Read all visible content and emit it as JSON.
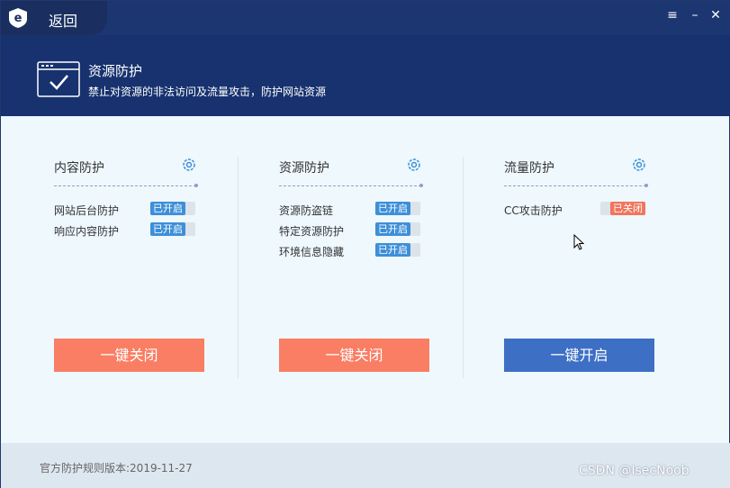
{
  "titlebar": {
    "back_label": "返回",
    "menu_icon": "hamburger-menu-icon",
    "minimize_icon": "minimize-icon",
    "close_icon": "close-icon"
  },
  "header": {
    "title": "资源防护",
    "subtitle": "禁止对资源的非法访问及流量攻击，防护网站资源",
    "icon": "browser-shield-check-icon"
  },
  "columns": [
    {
      "title": "内容防护",
      "rows": [
        {
          "label": "网站后台防护",
          "status": "已开启"
        },
        {
          "label": "响应内容防护",
          "status": "已开启"
        }
      ],
      "button": "一键关闭",
      "button_color": "#f97e64"
    },
    {
      "title": "资源防护",
      "rows": [
        {
          "label": "资源防盗链",
          "status": "已开启"
        },
        {
          "label": "特定资源防护",
          "status": "已开启"
        },
        {
          "label": "环境信息隐藏",
          "status": "已开启"
        }
      ],
      "button": "一键关闭",
      "button_color": "#f97e64"
    },
    {
      "title": "流量防护",
      "rows": [
        {
          "label": "CC攻击防护",
          "status": "已关闭"
        }
      ],
      "button": "一键开启",
      "button_color": "#3d6fc5"
    }
  ],
  "footer": {
    "version": "官方防护规则版本:2019-11-27",
    "watermark": "CSDN @IsecNoob"
  },
  "colors": {
    "on": "#3d8fd8",
    "off": "#f0765d",
    "header_bg": "#17326e"
  }
}
